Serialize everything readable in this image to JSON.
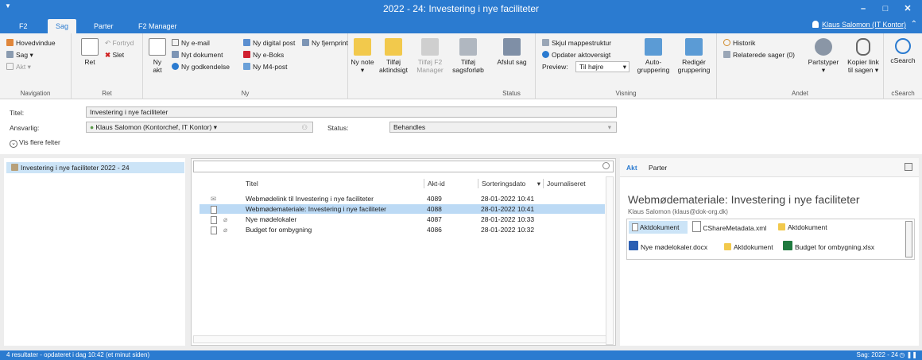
{
  "window": {
    "title": "2022 - 24: Investering i nye faciliteter"
  },
  "menu": {
    "tabs": [
      "F2",
      "Sag",
      "Parter",
      "F2 Manager"
    ],
    "active_tab": "Sag",
    "user": "Klaus Salomon (IT Kontor)"
  },
  "ribbon": {
    "navigation": {
      "label": "Navigation",
      "items": [
        "Hovedvindue",
        "Sag",
        "Akt"
      ]
    },
    "ret": {
      "label": "Ret",
      "ret_btn": "Ret",
      "fortryd": "Fortryd",
      "slet": "Slet"
    },
    "ny": {
      "label": "Ny",
      "ny_akt": "Ny akt",
      "items": [
        "Ny e-mail",
        "Nyt dokument",
        "Ny godkendelse",
        "Ny digital post",
        "Ny e-Boks",
        "Ny M4-post",
        "Ny fjernprint"
      ]
    },
    "big_buttons": [
      "Ny note",
      "Tilføj aktindsigt",
      "Tilføj F2 Manager",
      "Tilføj sagsforløb"
    ],
    "status": {
      "label": "Status",
      "afslut": "Afslut sag"
    },
    "visning": {
      "label": "Visning",
      "skjul": "Skjul mappestruktur",
      "opdater": "Opdater aktoversigt",
      "preview_label": "Preview:",
      "preview_value": "Til højre",
      "auto": "Auto-gruppering",
      "rediger": "Redigér gruppering"
    },
    "andet": {
      "label": "Andet",
      "historik": "Historik",
      "relaterede": "Relaterede sager (0)",
      "partstyper": "Partstyper",
      "kopier": "Kopier link til sagen"
    },
    "csearch": {
      "label": "cSearch",
      "btn": "cSearch"
    }
  },
  "form": {
    "titel_label": "Titel:",
    "titel_value": "Investering i nye faciliteter",
    "ansvarlig_label": "Ansvarlig:",
    "ansvarlig_value": "Klaus Salomon (Kontorchef, IT Kontor)",
    "status_label": "Status:",
    "status_value": "Behandles",
    "vis_flere": "Vis flere felter"
  },
  "tree": {
    "item": "Investering i nye faciliteter 2022 - 24"
  },
  "list": {
    "columns": [
      "Titel",
      "Akt-id",
      "Sorteringsdato",
      "Journaliseret"
    ],
    "rows": [
      {
        "titel": "Webmødelink til Investering i nye faciliteter",
        "akt_id": "4089",
        "dato": "28-01-2022 10:41"
      },
      {
        "titel": "Webmødemateriale: Investering i nye faciliteter",
        "akt_id": "4088",
        "dato": "28-01-2022 10:41"
      },
      {
        "titel": "Nye mødelokaler",
        "akt_id": "4087",
        "dato": "28-01-2022 10:33"
      },
      {
        "titel": "Budget for ombygning",
        "akt_id": "4086",
        "dato": "28-01-2022 10:32"
      }
    ]
  },
  "detail": {
    "tabs": [
      "Akt",
      "Parter"
    ],
    "title": "Webmødemateriale: Investering i nye faciliteter",
    "sender": "Klaus Salomon (klaus@dok-org.dk)",
    "attachments": [
      {
        "name": "Aktdokument"
      },
      {
        "name": "CShareMetadata.xml"
      },
      {
        "name": "Aktdokument"
      },
      {
        "name": "Nye mødelokaler.docx"
      },
      {
        "name": "Aktdokument"
      },
      {
        "name": "Budget for ombygning.xlsx"
      }
    ]
  },
  "statusbar": {
    "left": "4 resultater - opdateret i dag 10:42 (et minut siden)",
    "right": "Sag: 2022 - 24"
  },
  "colors": {
    "accent": "#2b7bd0",
    "selection": "#bcdaf5"
  }
}
